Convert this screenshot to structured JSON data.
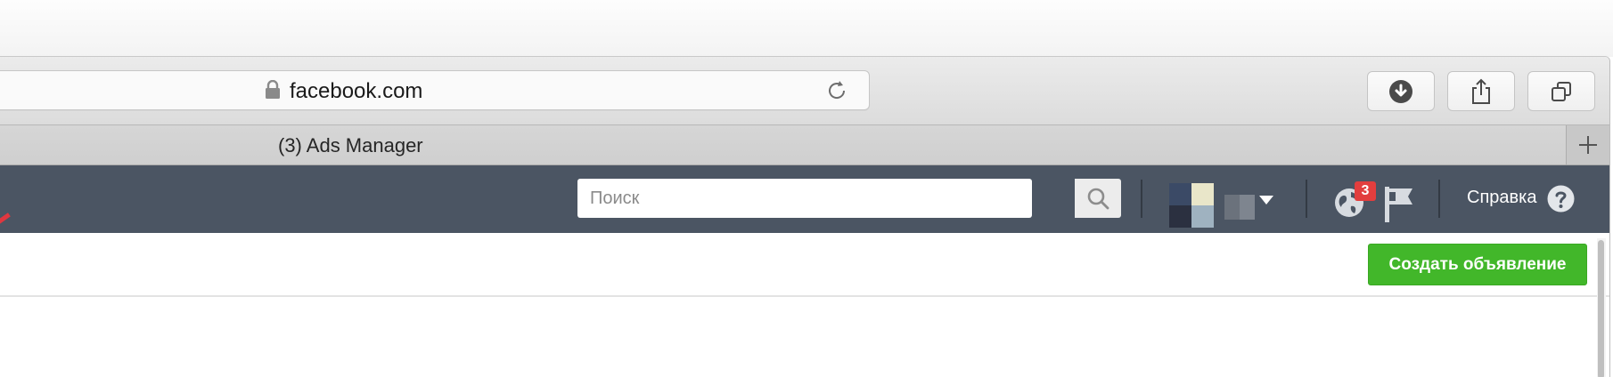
{
  "browser": {
    "url": "facebook.com",
    "tab_title": "(3) Ads Manager",
    "buttons": [
      "download-icon",
      "share-icon",
      "tabs-overview-icon"
    ],
    "new_tab_icon": "plus-icon"
  },
  "header": {
    "search": {
      "placeholder": "Поиск",
      "icon": "search-icon"
    },
    "notifications_count": "3",
    "help_label": "Справка",
    "background": "#4b5563"
  },
  "toolbar": {
    "create_ad_label": "Создать объявление",
    "accent": "#42b72a"
  }
}
